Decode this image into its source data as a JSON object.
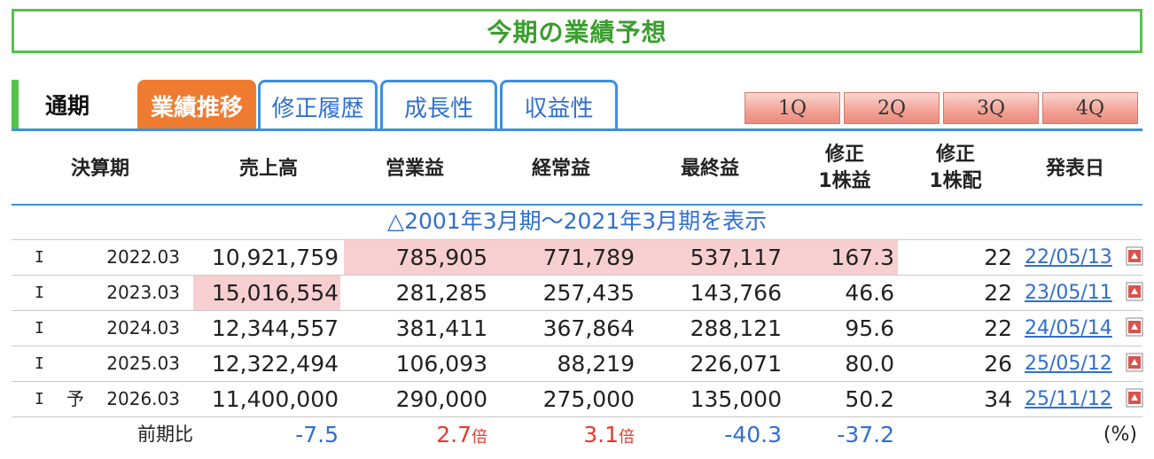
{
  "banner": {
    "title": "今期の業績予想"
  },
  "tabs": {
    "static": "通期",
    "items": [
      {
        "label": "業績推移",
        "active": true
      },
      {
        "label": "修正履歴",
        "active": false
      },
      {
        "label": "成長性",
        "active": false
      },
      {
        "label": "収益性",
        "active": false
      }
    ],
    "quarters": [
      "1Q",
      "2Q",
      "3Q",
      "4Q"
    ]
  },
  "table": {
    "headers": [
      "決算期",
      "売上高",
      "営業益",
      "経常益",
      "最終益",
      "修正\n1株益",
      "修正\n1株配",
      "発表日"
    ],
    "show_past_link": "△2001年3月期～2021年3月期を表示",
    "rows": [
      {
        "mark": "I",
        "yo": "",
        "period": "2022.03",
        "sales": "10,921,759",
        "op": "785,905",
        "ord": "771,789",
        "net": "537,117",
        "eps": "167.3",
        "div": "22",
        "date": "22/05/13"
      },
      {
        "mark": "I",
        "yo": "",
        "period": "2023.03",
        "sales": "15,016,554",
        "op": "281,285",
        "ord": "257,435",
        "net": "143,766",
        "eps": "46.6",
        "div": "22",
        "date": "23/05/11"
      },
      {
        "mark": "I",
        "yo": "",
        "period": "2024.03",
        "sales": "12,344,557",
        "op": "381,411",
        "ord": "367,864",
        "net": "288,121",
        "eps": "95.6",
        "div": "22",
        "date": "24/05/14"
      },
      {
        "mark": "I",
        "yo": "",
        "period": "2025.03",
        "sales": "12,322,494",
        "op": "106,093",
        "ord": "88,219",
        "net": "226,071",
        "eps": "80.0",
        "div": "26",
        "date": "25/05/12"
      },
      {
        "mark": "I",
        "yo": "予",
        "period": "2026.03",
        "sales": "11,400,000",
        "op": "290,000",
        "ord": "275,000",
        "net": "135,000",
        "eps": "50.2",
        "div": "34",
        "date": "25/11/12"
      }
    ],
    "yoy": {
      "label": "前期比",
      "sales": "-7.5",
      "op": "2.7",
      "op_unit": "倍",
      "ord": "3.1",
      "ord_unit": "倍",
      "net": "-40.3",
      "eps": "-37.2",
      "unit": "(%)"
    }
  },
  "colors": {
    "accent_green": "#55c24a",
    "tab_orange": "#ef7b31",
    "link_blue": "#2f6fd0",
    "highlight_pink": "#f8cfd0",
    "negative_blue": "#2f6fd0",
    "positive_red": "#e53a2c"
  }
}
